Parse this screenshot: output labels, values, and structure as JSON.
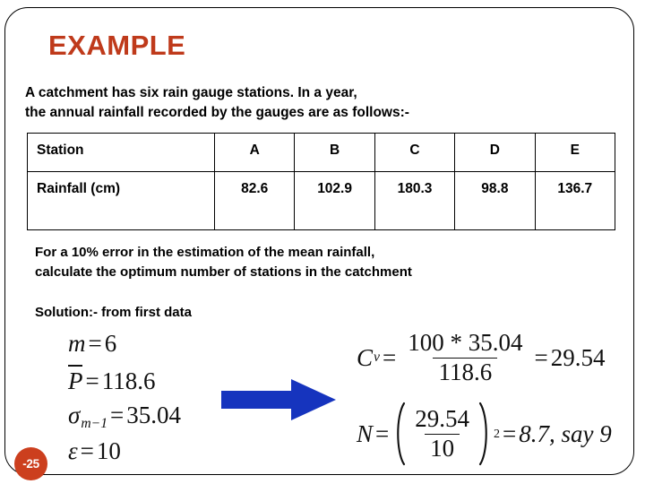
{
  "slide": {
    "title": "EXAMPLE",
    "title_color": "#BF3A1B",
    "frame_color": "#000000",
    "background": "#FFFFFF",
    "page_badge": "-25",
    "page_badge_color": "#CC3F1E"
  },
  "intro": {
    "text": "A catchment  has six rain gauge stations. In a year,\nthe annual rainfall recorded by the gauges are as follows:-"
  },
  "table": {
    "row_header_label": "Station",
    "row_value_label": "Rainfall (cm)",
    "stations": [
      "A",
      "B",
      "C",
      "D",
      "E"
    ],
    "rainfall_cm": [
      "82.6",
      "102.9",
      "180.3",
      "98.8",
      "136.7"
    ]
  },
  "question": {
    "text": "For a 10% error in the estimation  of the mean rainfall,\ncalculate the optimum number of stations in the catchment"
  },
  "solution": {
    "label": "Solution:- from first data",
    "given": {
      "m_symbol": "m",
      "m_eq": "=",
      "m_value": "6",
      "pbar_symbol": "P",
      "pbar_eq": "=",
      "pbar_value": "118.6",
      "sigma_symbol": "σ",
      "sigma_subscript": "m−1",
      "sigma_eq": "=",
      "sigma_value": "35.04",
      "epsilon_symbol": "ε",
      "epsilon_eq": "=",
      "epsilon_value": "10"
    },
    "arrow": {
      "name": "right-arrow",
      "color": "#1634BE"
    },
    "cv": {
      "symbol": "C",
      "subscript": "v",
      "eq1": "=",
      "numerator": "100 * 35.04",
      "denominator": "118.6",
      "eq2": "=",
      "result": "29.54"
    },
    "n": {
      "symbol": "N",
      "eq1": "=",
      "numerator": "29.54",
      "denominator": "10",
      "exponent": "2",
      "eq2": "=",
      "result": "8.7, say 9"
    }
  }
}
